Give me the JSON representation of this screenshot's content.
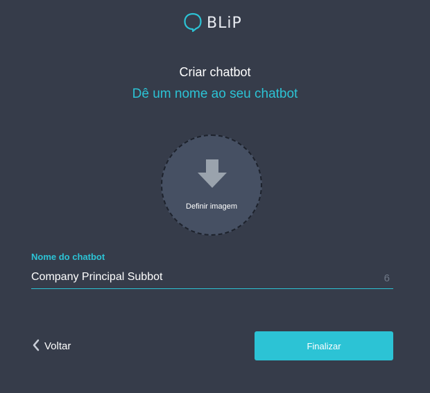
{
  "brand": {
    "logo_text": "BLiP",
    "logo_icon": "speech-bubble-icon",
    "accent_color": "#2cc3d5",
    "background_color": "#363c4a"
  },
  "header": {
    "title": "Criar chatbot",
    "subtitle": "Dê um nome ao seu chatbot"
  },
  "avatar": {
    "icon": "download-arrow-icon",
    "label": "Definir imagem"
  },
  "name_field": {
    "label": "Nome do chatbot",
    "value": "Company Principal Subbot",
    "counter": "6"
  },
  "actions": {
    "back_icon": "chevron-left-icon",
    "back_label": "Voltar",
    "finish_label": "Finalizar"
  }
}
